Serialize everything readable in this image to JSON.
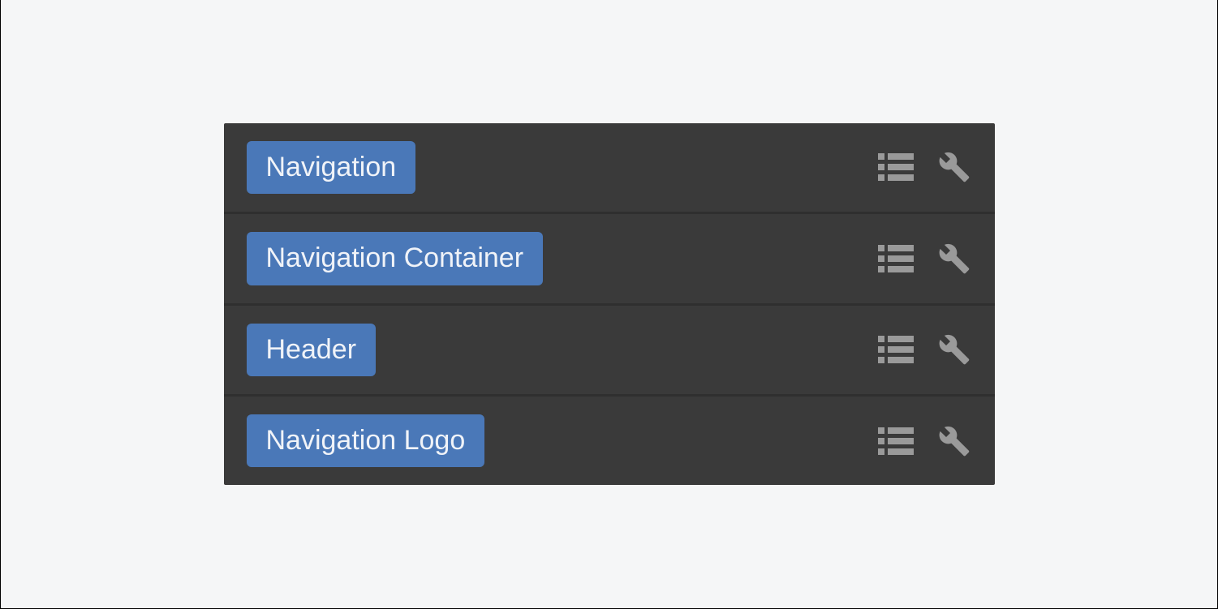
{
  "items": [
    {
      "label": "Navigation"
    },
    {
      "label": "Navigation Container"
    },
    {
      "label": "Header"
    },
    {
      "label": "Navigation Logo"
    }
  ]
}
